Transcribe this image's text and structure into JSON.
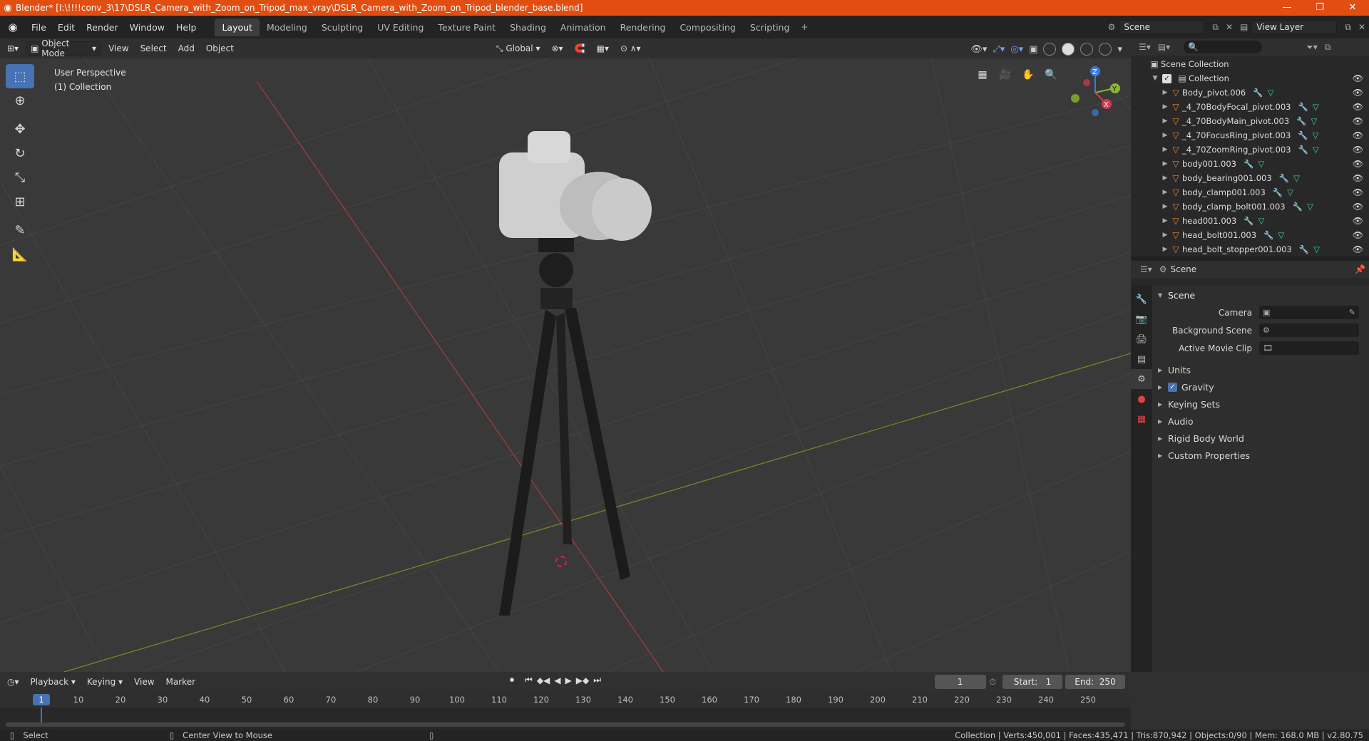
{
  "title": "Blender* [I:\\!!!!conv_3\\17\\DSLR_Camera_with_Zoom_on_Tripod_max_vray\\DSLR_Camera_with_Zoom_on_Tripod_blender_base.blend]",
  "menu": [
    "File",
    "Edit",
    "Render",
    "Window",
    "Help"
  ],
  "workspaces": [
    "Layout",
    "Modeling",
    "Sculpting",
    "UV Editing",
    "Texture Paint",
    "Shading",
    "Animation",
    "Rendering",
    "Compositing",
    "Scripting"
  ],
  "scene_name": "Scene",
  "view_layer": "View Layer",
  "viewport": {
    "mode": "Object Mode",
    "menus": [
      "View",
      "Select",
      "Add",
      "Object"
    ],
    "orientation": "Global",
    "perspective": "User Perspective",
    "collection": "(1) Collection"
  },
  "outliner": {
    "root": "Scene Collection",
    "collection": "Collection",
    "items": [
      "Body_pivot.006",
      "_4_70BodyFocal_pivot.003",
      "_4_70BodyMain_pivot.003",
      "_4_70FocusRing_pivot.003",
      "_4_70ZoomRing_pivot.003",
      "body001.003",
      "body_bearing001.003",
      "body_clamp001.003",
      "body_clamp_bolt001.003",
      "head001.003",
      "head_bolt001.003",
      "head_bolt_stopper001.003"
    ]
  },
  "properties": {
    "header": "Scene",
    "panel": "Scene",
    "fields": [
      {
        "label": "Camera"
      },
      {
        "label": "Background Scene"
      },
      {
        "label": "Active Movie Clip"
      }
    ],
    "sections": [
      "Units",
      "Gravity",
      "Keying Sets",
      "Audio",
      "Rigid Body World",
      "Custom Properties"
    ]
  },
  "timeline": {
    "menus": [
      "Playback",
      "Keying",
      "View",
      "Marker"
    ],
    "current": "1",
    "start_label": "Start:",
    "start": "1",
    "end_label": "End:",
    "end": "250",
    "ticks": [
      "10",
      "20",
      "30",
      "40",
      "50",
      "60",
      "70",
      "80",
      "90",
      "100",
      "110",
      "120",
      "130",
      "140",
      "150",
      "160",
      "170",
      "180",
      "190",
      "200",
      "210",
      "220",
      "230",
      "240",
      "250"
    ],
    "current_marker": "1"
  },
  "status": {
    "left": "Select",
    "middle": "Center View to Mouse",
    "right": "Collection | Verts:450,001 | Faces:435,471 | Tris:870,942 | Objects:0/90 | Mem: 168.0 MB | v2.80.75"
  }
}
